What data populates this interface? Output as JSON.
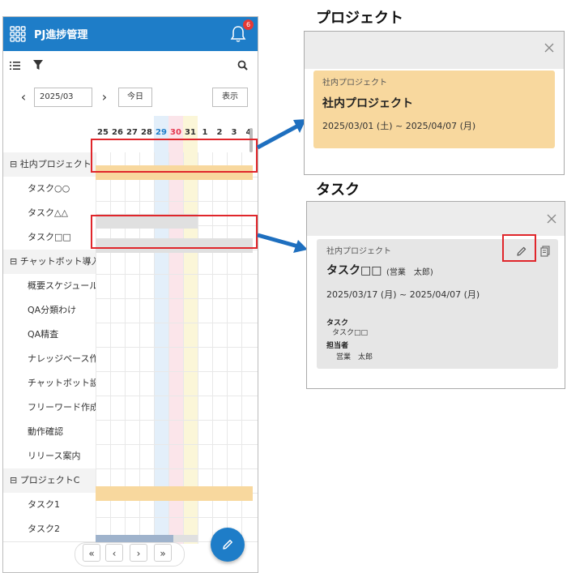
{
  "app": {
    "title": "PJ進捗管理",
    "notification_count": "6"
  },
  "toolbar": {
    "list_icon": "list-icon",
    "filter_icon": "filter-icon",
    "search_icon": "search-icon"
  },
  "date_nav": {
    "prev": "‹",
    "month": "2025/03",
    "next": "›",
    "today_label": "今日",
    "show_label": "表示"
  },
  "gantt": {
    "days": [
      "25",
      "26",
      "27",
      "28",
      "29",
      "30",
      "31",
      "1",
      "2",
      "3",
      "4"
    ],
    "day_colors": [
      "#333333",
      "#333333",
      "#333333",
      "#333333",
      "#1e7dc8",
      "#e53950",
      "#333333",
      "#333333",
      "#333333",
      "#333333",
      "#333333"
    ],
    "rows": [
      {
        "label": "⊟ 社内プロジェクト",
        "type": "project"
      },
      {
        "label": "タスク○○",
        "type": "task"
      },
      {
        "label": "タスク△△",
        "type": "task"
      },
      {
        "label": "タスク□□",
        "type": "task"
      },
      {
        "label": "⊟ チャットボット導入",
        "type": "project"
      },
      {
        "label": "概要スケジュール…",
        "type": "task"
      },
      {
        "label": "QA分類わけ",
        "type": "task"
      },
      {
        "label": "QA精査",
        "type": "task"
      },
      {
        "label": "ナレッジベース作成",
        "type": "task"
      },
      {
        "label": "チャットボット設定",
        "type": "task"
      },
      {
        "label": "フリーワード作成",
        "type": "task"
      },
      {
        "label": "動作確認",
        "type": "task"
      },
      {
        "label": "リリース案内",
        "type": "task"
      },
      {
        "label": "⊟ プロジェクトC",
        "type": "project"
      },
      {
        "label": "タスク1",
        "type": "task"
      },
      {
        "label": "タスク2",
        "type": "task"
      }
    ]
  },
  "pager": {
    "first": "«",
    "prev": "‹",
    "next": "›",
    "last": "»"
  },
  "callout_project": {
    "heading": "プロジェクト",
    "project_small": "社内プロジェクト",
    "project_name": "社内プロジェクト",
    "period": "2025/03/01 (土) ~ 2025/04/07 (月)"
  },
  "callout_task": {
    "heading": "タスク",
    "project_small": "社内プロジェクト",
    "task_name": "タスク□□",
    "assignee_inline": "(営業　太郎)",
    "period": "2025/03/17 (月) ~ 2025/04/07 (月)",
    "task_label": "タスク",
    "task_value": "タスク□□",
    "owner_label": "担当者",
    "owner_value": "営業　太郎"
  },
  "colors": {
    "accent": "#1e7dc8",
    "project_bar": "#f8d89e",
    "task_bar": "#e0e0e0",
    "highlight": "#e0262b"
  }
}
